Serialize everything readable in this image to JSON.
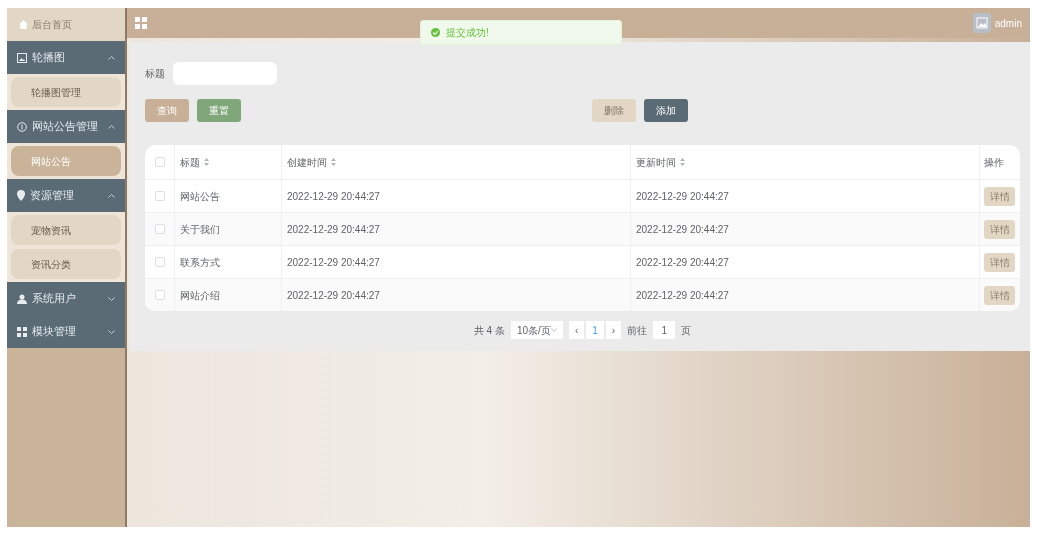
{
  "sidebar": {
    "home": {
      "label": "后台首页"
    },
    "menus": [
      {
        "label": "轮播图",
        "expanded": true,
        "items": [
          {
            "label": "轮播图管理",
            "selected": false
          }
        ]
      },
      {
        "label": "网站公告管理",
        "expanded": true,
        "items": [
          {
            "label": "网站公告",
            "selected": true
          }
        ]
      },
      {
        "label": "资源管理",
        "expanded": true,
        "items": [
          {
            "label": "宠物资讯",
            "selected": false
          },
          {
            "label": "资讯分类",
            "selected": false
          }
        ]
      },
      {
        "label": "系统用户",
        "expanded": false
      },
      {
        "label": "模块管理",
        "expanded": false
      }
    ]
  },
  "header": {
    "user": "admin"
  },
  "toast": {
    "message": "提交成功!"
  },
  "search": {
    "label": "标题"
  },
  "buttons": [
    {
      "label": "查询",
      "kind": "query"
    },
    {
      "label": "重置",
      "kind": "reset"
    }
  ],
  "actions": [
    {
      "label": "删除",
      "kind": "delete",
      "disabled": true
    },
    {
      "label": "添加",
      "kind": "add",
      "disabled": false
    }
  ],
  "table": {
    "header_checked": false,
    "columns": [
      {
        "label": "标题",
        "sortable": true
      },
      {
        "label": "创建时间",
        "sortable": true
      },
      {
        "label": "更新时间",
        "sortable": true
      },
      {
        "label": "操作",
        "sortable": false
      }
    ],
    "rows": [
      {
        "checked": false,
        "title": "网站公告",
        "created": "2022-12-29 20:44:27",
        "updated": "2022-12-29 20:44:27",
        "action": "详情"
      },
      {
        "checked": false,
        "title": "关于我们",
        "created": "2022-12-29 20:44:27",
        "updated": "2022-12-29 20:44:27",
        "action": "详情"
      },
      {
        "checked": false,
        "title": "联系方式",
        "created": "2022-12-29 20:44:27",
        "updated": "2022-12-29 20:44:27",
        "action": "详情"
      },
      {
        "checked": false,
        "title": "网站介绍",
        "created": "2022-12-29 20:44:27",
        "updated": "2022-12-29 20:44:27",
        "action": "详情"
      }
    ]
  },
  "pagination": {
    "total": "共 4 条",
    "page_size": "10条/页",
    "prev": "‹",
    "pages": [
      {
        "label": "1",
        "selected": true
      }
    ],
    "next": "›",
    "goto_label": "前往",
    "goto_value": "1",
    "page_suffix": "页"
  }
}
